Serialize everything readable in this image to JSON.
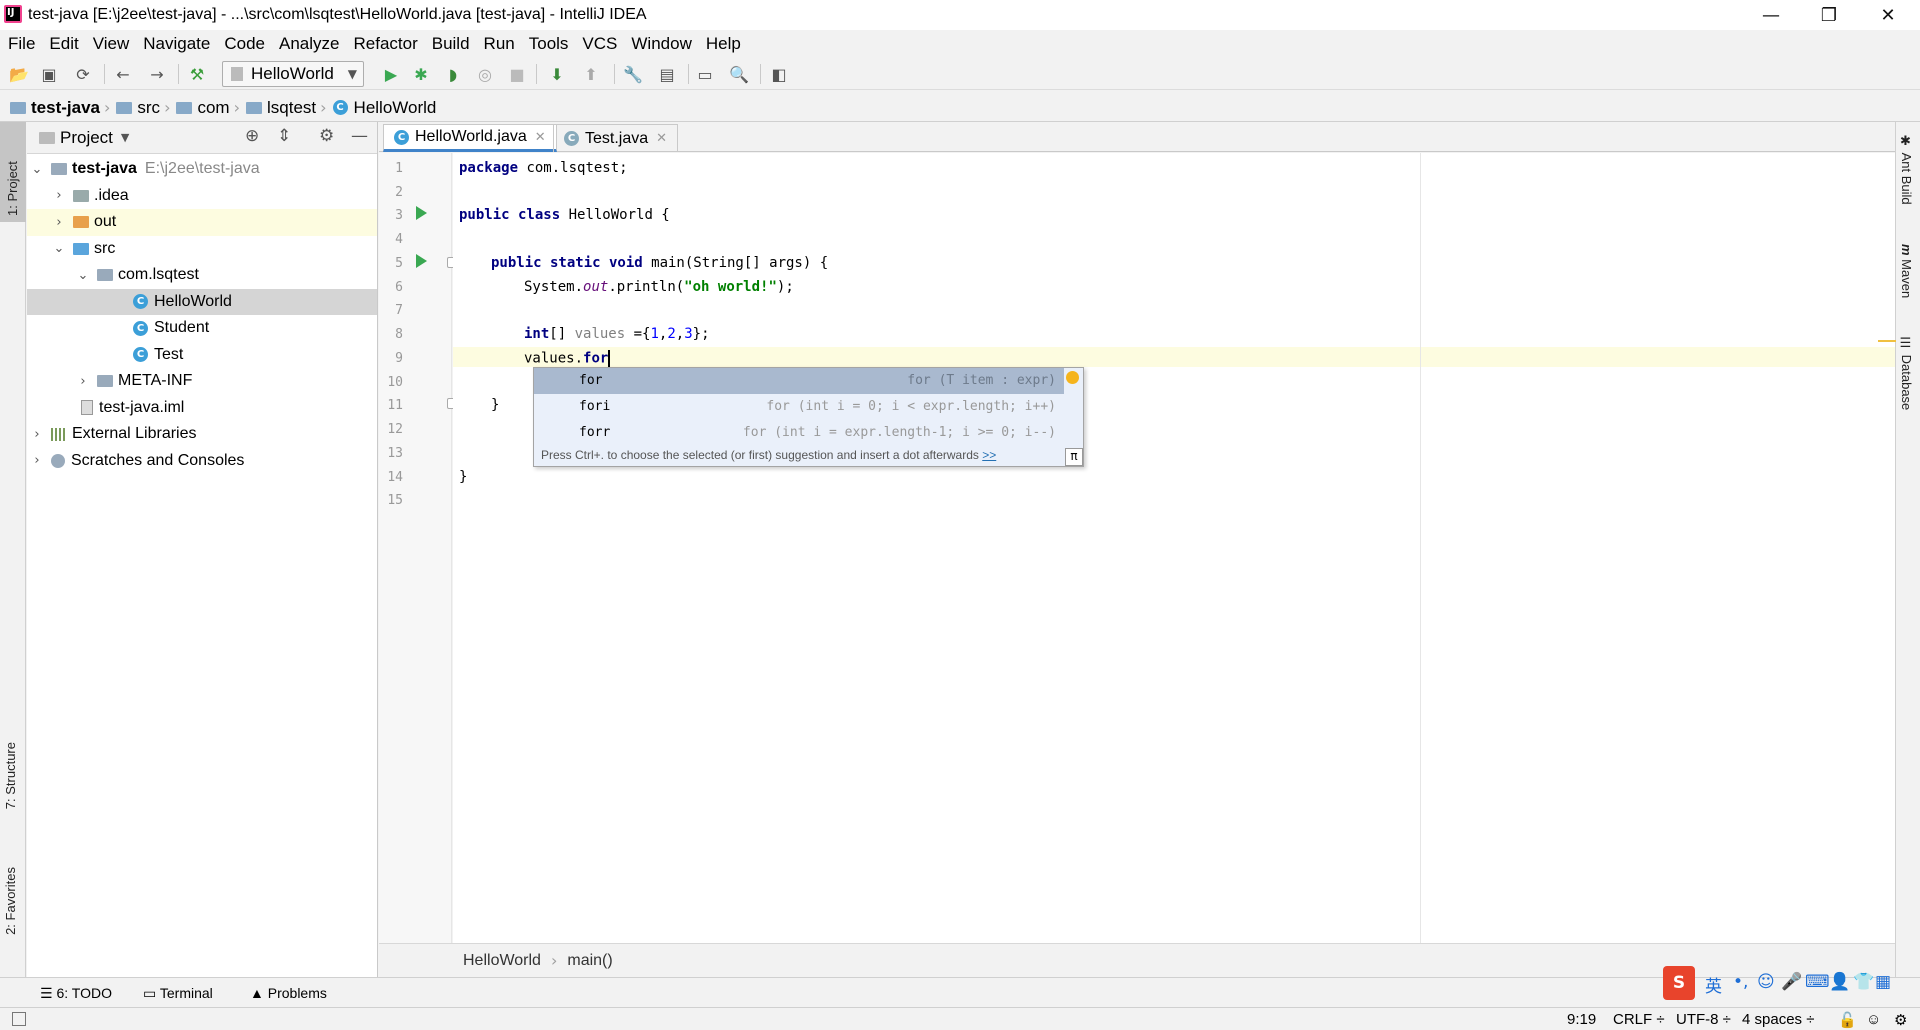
{
  "window": {
    "title": "test-java [E:\\j2ee\\test-java] - ...\\src\\com\\lsqtest\\HelloWorld.java [test-java] - IntelliJ IDEA",
    "minimize": "—",
    "restore": "❐",
    "close": "✕"
  },
  "menu": [
    "File",
    "Edit",
    "View",
    "Navigate",
    "Code",
    "Analyze",
    "Refactor",
    "Build",
    "Run",
    "Tools",
    "VCS",
    "Window",
    "Help"
  ],
  "toolbar": {
    "run_config": "HelloWorld"
  },
  "navbar": {
    "items": [
      "test-java",
      "src",
      "com",
      "lsqtest",
      "HelloWorld"
    ]
  },
  "left_strip": {
    "project_tab": "1: Project",
    "structure_tab": "7: Structure",
    "favorites_tab": "2: Favorites"
  },
  "project": {
    "title": "Project",
    "root_name": "test-java",
    "root_path": "E:\\j2ee\\test-java",
    "items": [
      ".idea",
      "out",
      "src",
      "com.lsqtest",
      "HelloWorld",
      "Student",
      "Test",
      "META-INF",
      "test-java.iml",
      "External Libraries",
      "Scratches and Consoles"
    ]
  },
  "tabs": [
    "HelloWorld.java",
    "Test.java"
  ],
  "editor": {
    "line_numbers": [
      "1",
      "2",
      "3",
      "4",
      "5",
      "6",
      "7",
      "8",
      "9",
      "10",
      "11",
      "12",
      "13",
      "14",
      "15"
    ],
    "lines": {
      "l1_kw": "package",
      "l1_rest": " com.lsqtest;",
      "l3_kw": "public class",
      "l3_rest": " HelloWorld {",
      "l5_kw": "public static void",
      "l5_rest": " main(String[] args) {",
      "l6_a": "System.",
      "l6_field": "out",
      "l6_b": ".println(",
      "l6_str": "\"oh world!\"",
      "l6_c": ");",
      "l8_kw": "int",
      "l8_a": "[] ",
      "l8_var": "values",
      "l8_b": " ={",
      "l8_n1": "1",
      "l8_c1": ",",
      "l8_n2": "2",
      "l8_c2": ",",
      "l8_n3": "3",
      "l8_d": "};",
      "l9_a": "values.",
      "l9_kw": "for",
      "l11": "}",
      "l14": "}"
    }
  },
  "completion": {
    "items": [
      {
        "name": "for",
        "desc": "for (T item : expr)"
      },
      {
        "name": "fori",
        "desc": "for (int i = 0; i < expr.length; i++)"
      },
      {
        "name": "forr",
        "desc": "for (int i = expr.length-1; i >= 0; i--)"
      }
    ],
    "hint": "Press Ctrl+. to choose the selected (or first) suggestion and insert a dot afterwards",
    "hint_link": ">>",
    "pi": "π"
  },
  "editor_breadcrumb": [
    "HelloWorld",
    "main()"
  ],
  "right_strip": {
    "ant": "Ant Build",
    "maven": "Maven",
    "database": "Database"
  },
  "bottom_tools": {
    "todo": "6: TODO",
    "terminal": "Terminal",
    "problems": "Problems"
  },
  "status": {
    "position": "9:19",
    "line_sep": "CRLF ÷",
    "encoding": "UTF-8 ÷",
    "indent": "4 spaces ÷"
  },
  "ime": {
    "lang": "英"
  },
  "colors": {
    "keyword": "#000080",
    "string": "#008000",
    "selected_suggestion": "#a9b9cf",
    "current_line": "#fdfce0"
  }
}
